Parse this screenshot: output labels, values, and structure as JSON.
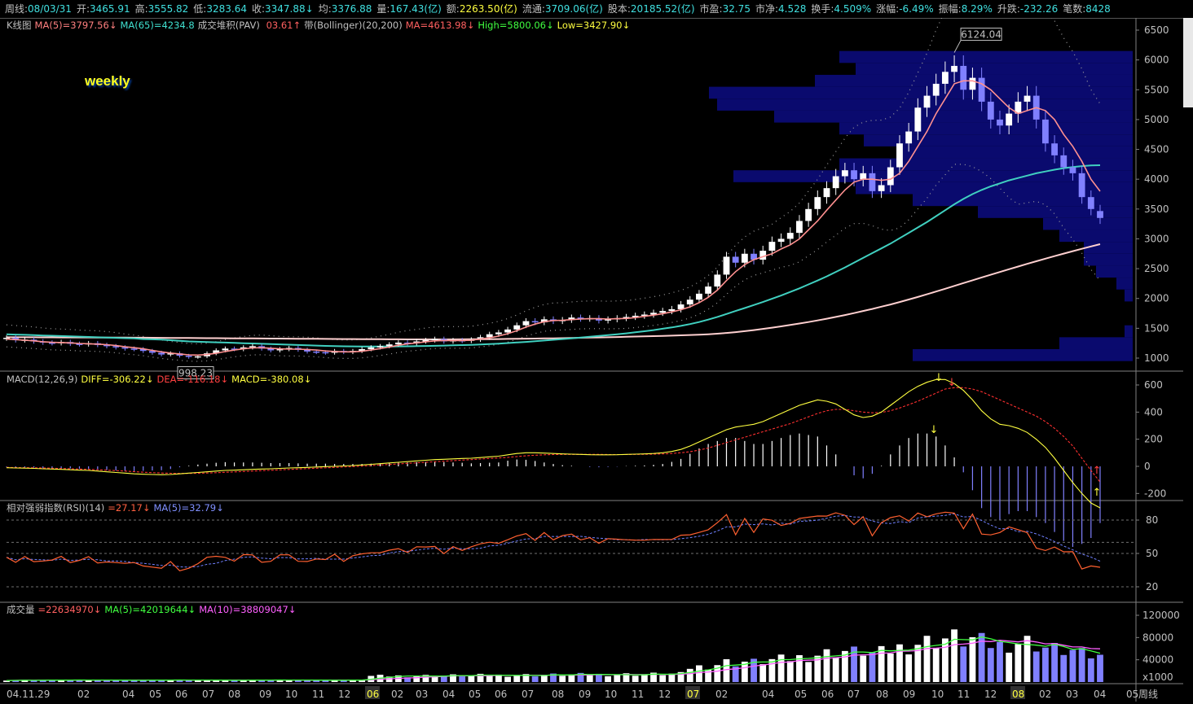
{
  "header": {
    "items": [
      {
        "label": "周线:",
        "value": "08/03/31",
        "cls": "v-cyan"
      },
      {
        "label": "开:",
        "value": "3465.91",
        "cls": "v-cyan"
      },
      {
        "label": "高:",
        "value": "3555.82",
        "cls": "v-cyan"
      },
      {
        "label": "低:",
        "value": "3283.64",
        "cls": "v-cyan"
      },
      {
        "label": "收:",
        "value": "3347.88↓",
        "cls": "v-cyan"
      },
      {
        "label": "均:",
        "value": "3376.88",
        "cls": "v-cyan"
      },
      {
        "label": "量:",
        "value": "167.43(亿)",
        "cls": "v-cyan"
      },
      {
        "label": "额:",
        "value": "2263.50(亿)",
        "cls": "v-yel"
      },
      {
        "label": "流通:",
        "value": "3709.06(亿)",
        "cls": "v-cyan"
      },
      {
        "label": "股本:",
        "value": "20185.52(亿)",
        "cls": "v-cyan"
      },
      {
        "label": "市盈:",
        "value": "32.75",
        "cls": "v-cyan"
      },
      {
        "label": "市净:",
        "value": "4.528",
        "cls": "v-cyan"
      },
      {
        "label": "换手:",
        "value": "4.509%",
        "cls": "v-cyan"
      },
      {
        "label": "涨幅:",
        "value": "-6.49%",
        "cls": "v-cyan"
      },
      {
        "label": "振幅:",
        "value": "8.29%",
        "cls": "v-cyan"
      },
      {
        "label": "升跌:",
        "value": "-232.26",
        "cls": "v-cyan"
      },
      {
        "label": "笔数:",
        "value": "8428",
        "cls": "v-cyan"
      }
    ]
  },
  "panels": {
    "kline": {
      "name": "K线图",
      "indicators": [
        {
          "text": "MA(5)=3797.56↓",
          "color": "#ff8080"
        },
        {
          "text": "MA(65)=4234.8",
          "color": "#40e0d0"
        },
        {
          "text": "成交堆积(PAV) ",
          "color": "#c0c0c0"
        },
        {
          "text": "03.61↑",
          "color": "#ff6060"
        },
        {
          "text": "带(Bollinger)(20,200)",
          "color": "#c0c0c0"
        },
        {
          "text": "MA=4613.98↓",
          "color": "#ff6060"
        },
        {
          "text": "High=5800.06↓",
          "color": "#40ff40"
        },
        {
          "text": "Low=3427.90↓",
          "color": "#ffff40"
        }
      ]
    },
    "macd": {
      "name": "MACD",
      "params": "(12,26,9)",
      "indicators": [
        {
          "text": "DIFF=-306.22↓",
          "color": "#ffff40"
        },
        {
          "text": "DEA=-116.18↓",
          "color": "#ff4040"
        },
        {
          "text": "MACD=-380.08↓",
          "color": "#ffff40"
        }
      ]
    },
    "rsi": {
      "name": "相对强弱指数(RSI)",
      "params": "(14)",
      "indicators": [
        {
          "text": "=27.17↓",
          "color": "#ff6040"
        },
        {
          "text": "MA(5)=32.79↓",
          "color": "#8090ff"
        }
      ]
    },
    "vol": {
      "name": "成交量",
      "indicators": [
        {
          "text": "=22634970↓",
          "color": "#ff6060"
        },
        {
          "text": "MA(5)=42019644↓",
          "color": "#40ff40"
        },
        {
          "text": "MA(10)=38809047↓",
          "color": "#ff60ff"
        }
      ]
    }
  },
  "watermark": "weekly",
  "chart_data": {
    "type": "candlestick",
    "period": "weekly",
    "x_axis_labels": [
      "04.11.29",
      "02",
      "04",
      "05",
      "06",
      "07",
      "08",
      "09",
      "10",
      "11",
      "12",
      "06",
      "02",
      "03",
      "04",
      "05",
      "06",
      "07",
      "08",
      "09",
      "10",
      "11",
      "12",
      "07",
      "02",
      "04",
      "05",
      "06",
      "07",
      "08",
      "09",
      "10",
      "11",
      "12",
      "08",
      "02",
      "03",
      "04",
      "05",
      "周线"
    ],
    "year_marks": [
      "06",
      "07",
      "08"
    ],
    "price_ticks": [
      1000,
      1500,
      2000,
      2500,
      3000,
      3500,
      4000,
      4500,
      5000,
      5500,
      6000,
      6500
    ],
    "macd_ticks": [
      600,
      400,
      200,
      0,
      -200
    ],
    "rsi_ticks": [
      80,
      50,
      20
    ],
    "rsi_levels": [
      20,
      50,
      60,
      80
    ],
    "vol_ticks": [
      "120000",
      "80000",
      "40000",
      "x1000"
    ],
    "annotations": {
      "high": "6124.04",
      "low": "998.23"
    },
    "close": [
      1340,
      1300,
      1310,
      1280,
      1260,
      1250,
      1270,
      1240,
      1230,
      1250,
      1220,
      1200,
      1180,
      1160,
      1150,
      1120,
      1090,
      1060,
      1080,
      1040,
      1020,
      1030,
      1080,
      1130,
      1160,
      1150,
      1180,
      1200,
      1160,
      1130,
      1150,
      1170,
      1140,
      1110,
      1100,
      1090,
      1120,
      1100,
      1120,
      1150,
      1180,
      1200,
      1230,
      1260,
      1250,
      1280,
      1300,
      1320,
      1280,
      1300,
      1290,
      1310,
      1350,
      1400,
      1430,
      1480,
      1550,
      1620,
      1600,
      1650,
      1620,
      1640,
      1680,
      1660,
      1670,
      1630,
      1650,
      1670,
      1690,
      1710,
      1730,
      1760,
      1790,
      1820,
      1900,
      1980,
      2080,
      2200,
      2400,
      2700,
      2600,
      2750,
      2650,
      2800,
      2950,
      3000,
      3100,
      3300,
      3500,
      3700,
      3850,
      4050,
      4150,
      4000,
      4100,
      3800,
      3900,
      4200,
      4600,
      4800,
      5200,
      5400,
      5600,
      5800,
      5900,
      5500,
      5700,
      5300,
      5000,
      4900,
      5100,
      5300,
      5400,
      5000,
      4600,
      4400,
      4200,
      4100,
      3700,
      3500,
      3350
    ],
    "open": [
      1330,
      1340,
      1300,
      1310,
      1280,
      1260,
      1250,
      1270,
      1240,
      1230,
      1250,
      1220,
      1200,
      1180,
      1160,
      1150,
      1120,
      1090,
      1060,
      1080,
      1040,
      1020,
      1030,
      1080,
      1130,
      1160,
      1150,
      1180,
      1200,
      1160,
      1130,
      1150,
      1170,
      1140,
      1110,
      1100,
      1090,
      1120,
      1100,
      1120,
      1150,
      1180,
      1200,
      1230,
      1260,
      1250,
      1280,
      1300,
      1320,
      1280,
      1300,
      1290,
      1310,
      1350,
      1400,
      1430,
      1480,
      1550,
      1620,
      1600,
      1650,
      1620,
      1640,
      1680,
      1660,
      1670,
      1630,
      1650,
      1670,
      1690,
      1710,
      1730,
      1760,
      1790,
      1820,
      1900,
      1980,
      2080,
      2200,
      2400,
      2700,
      2600,
      2750,
      2650,
      2800,
      2950,
      3000,
      3100,
      3300,
      3500,
      3700,
      3850,
      4050,
      4150,
      4000,
      4100,
      3800,
      3900,
      4200,
      4600,
      4800,
      5200,
      5400,
      5600,
      5800,
      5900,
      5500,
      5700,
      5300,
      5000,
      4900,
      5100,
      5300,
      5400,
      5000,
      4600,
      4400,
      4200,
      4100,
      3700,
      3466
    ],
    "ma5": [
      1320,
      1310,
      1300,
      1290,
      1275,
      1265,
      1260,
      1255,
      1245,
      1240,
      1235,
      1225,
      1210,
      1190,
      1175,
      1155,
      1130,
      1105,
      1085,
      1070,
      1055,
      1050,
      1060,
      1080,
      1110,
      1135,
      1155,
      1170,
      1175,
      1165,
      1155,
      1150,
      1150,
      1145,
      1135,
      1120,
      1110,
      1105,
      1105,
      1115,
      1135,
      1160,
      1185,
      1215,
      1240,
      1255,
      1275,
      1290,
      1295,
      1295,
      1295,
      1300,
      1320,
      1340,
      1370,
      1410,
      1460,
      1520,
      1570,
      1610,
      1630,
      1635,
      1645,
      1655,
      1660,
      1660,
      1655,
      1660,
      1665,
      1680,
      1700,
      1720,
      1745,
      1775,
      1810,
      1860,
      1930,
      2020,
      2140,
      2300,
      2450,
      2570,
      2650,
      2700,
      2750,
      2830,
      2900,
      3000,
      3150,
      3300,
      3480,
      3650,
      3820,
      3950,
      4000,
      4000,
      3980,
      4000,
      4100,
      4300,
      4550,
      4800,
      5100,
      5350,
      5600,
      5650,
      5650,
      5600,
      5500,
      5350,
      5200,
      5100,
      5150,
      5200,
      5150,
      5000,
      4750,
      4550,
      4300,
      4000,
      3798
    ],
    "ma65": [
      1400,
      1395,
      1390,
      1385,
      1380,
      1375,
      1370,
      1365,
      1360,
      1355,
      1350,
      1345,
      1340,
      1335,
      1330,
      1320,
      1315,
      1310,
      1300,
      1290,
      1280,
      1275,
      1270,
      1265,
      1260,
      1255,
      1250,
      1245,
      1240,
      1235,
      1230,
      1225,
      1220,
      1215,
      1210,
      1205,
      1200,
      1198,
      1196,
      1195,
      1194,
      1194,
      1195,
      1196,
      1198,
      1200,
      1203,
      1206,
      1210,
      1214,
      1218,
      1222,
      1228,
      1235,
      1243,
      1252,
      1262,
      1272,
      1283,
      1295,
      1307,
      1320,
      1332,
      1345,
      1358,
      1372,
      1386,
      1400,
      1415,
      1432,
      1450,
      1470,
      1492,
      1515,
      1540,
      1570,
      1605,
      1645,
      1690,
      1740,
      1790,
      1840,
      1890,
      1940,
      1995,
      2050,
      2110,
      2170,
      2235,
      2300,
      2370,
      2445,
      2520,
      2600,
      2680,
      2760,
      2840,
      2920,
      3010,
      3100,
      3190,
      3280,
      3380,
      3480,
      3580,
      3670,
      3750,
      3820,
      3880,
      3930,
      3980,
      4020,
      4060,
      4100,
      4130,
      4160,
      4185,
      4205,
      4220,
      4230,
      4235
    ],
    "ma200": [
      1350,
      1350,
      1349,
      1349,
      1348,
      1348,
      1347,
      1347,
      1346,
      1346,
      1345,
      1345,
      1344,
      1344,
      1343,
      1342,
      1341,
      1340,
      1339,
      1338,
      1337,
      1336,
      1335,
      1334,
      1333,
      1332,
      1331,
      1330,
      1329,
      1328,
      1327,
      1326,
      1325,
      1324,
      1323,
      1322,
      1321,
      1320,
      1319,
      1318,
      1317,
      1316,
      1315,
      1315,
      1314,
      1314,
      1314,
      1314,
      1314,
      1314,
      1315,
      1316,
      1317,
      1318,
      1320,
      1322,
      1324,
      1326,
      1328,
      1330,
      1332,
      1335,
      1338,
      1341,
      1344,
      1347,
      1350,
      1353,
      1357,
      1361,
      1365,
      1369,
      1373,
      1377,
      1382,
      1387,
      1393,
      1400,
      1410,
      1422,
      1436,
      1452,
      1470,
      1490,
      1510,
      1532,
      1555,
      1580,
      1605,
      1632,
      1660,
      1690,
      1722,
      1755,
      1790,
      1825,
      1862,
      1900,
      1940,
      1982,
      2025,
      2070,
      2116,
      2163,
      2210,
      2258,
      2305,
      2352,
      2398,
      2444,
      2490,
      2535,
      2580,
      2624,
      2668,
      2710,
      2752,
      2793,
      2833,
      2872,
      2910
    ],
    "macd_diff": [
      -10,
      -12,
      -13,
      -15,
      -18,
      -20,
      -22,
      -25,
      -28,
      -30,
      -35,
      -40,
      -45,
      -50,
      -55,
      -58,
      -60,
      -62,
      -60,
      -55,
      -50,
      -45,
      -40,
      -35,
      -30,
      -28,
      -25,
      -22,
      -20,
      -18,
      -15,
      -12,
      -10,
      -8,
      -5,
      -2,
      0,
      3,
      6,
      10,
      15,
      20,
      25,
      30,
      35,
      40,
      45,
      50,
      52,
      55,
      58,
      60,
      65,
      70,
      75,
      85,
      95,
      100,
      100,
      98,
      95,
      92,
      90,
      88,
      86,
      85,
      85,
      86,
      88,
      90,
      92,
      95,
      100,
      110,
      125,
      150,
      180,
      210,
      240,
      270,
      290,
      300,
      310,
      330,
      360,
      390,
      420,
      450,
      470,
      490,
      480,
      460,
      420,
      380,
      360,
      370,
      400,
      450,
      500,
      550,
      590,
      620,
      640,
      640,
      610,
      560,
      490,
      410,
      350,
      310,
      300,
      280,
      250,
      200,
      140,
      60,
      -30,
      -120,
      -200,
      -270,
      -306
    ],
    "macd_dea": [
      -8,
      -9,
      -10,
      -11,
      -12,
      -14,
      -16,
      -18,
      -20,
      -22,
      -25,
      -28,
      -31,
      -35,
      -39,
      -43,
      -46,
      -49,
      -51,
      -52,
      -52,
      -51,
      -49,
      -47,
      -44,
      -41,
      -38,
      -35,
      -32,
      -29,
      -26,
      -23,
      -20,
      -17,
      -14,
      -11,
      -8,
      -5,
      -2,
      2,
      6,
      10,
      14,
      18,
      22,
      26,
      30,
      34,
      38,
      42,
      46,
      50,
      54,
      58,
      62,
      66,
      72,
      78,
      82,
      85,
      87,
      88,
      88,
      88,
      88,
      88,
      87,
      87,
      87,
      88,
      89,
      90,
      92,
      95,
      100,
      108,
      120,
      135,
      155,
      175,
      195,
      215,
      235,
      255,
      275,
      295,
      315,
      340,
      365,
      390,
      410,
      420,
      420,
      410,
      400,
      395,
      398,
      410,
      430,
      455,
      480,
      510,
      540,
      570,
      580,
      580,
      570,
      550,
      520,
      490,
      460,
      430,
      400,
      370,
      330,
      280,
      220,
      150,
      60,
      -30,
      -116
    ]
  }
}
